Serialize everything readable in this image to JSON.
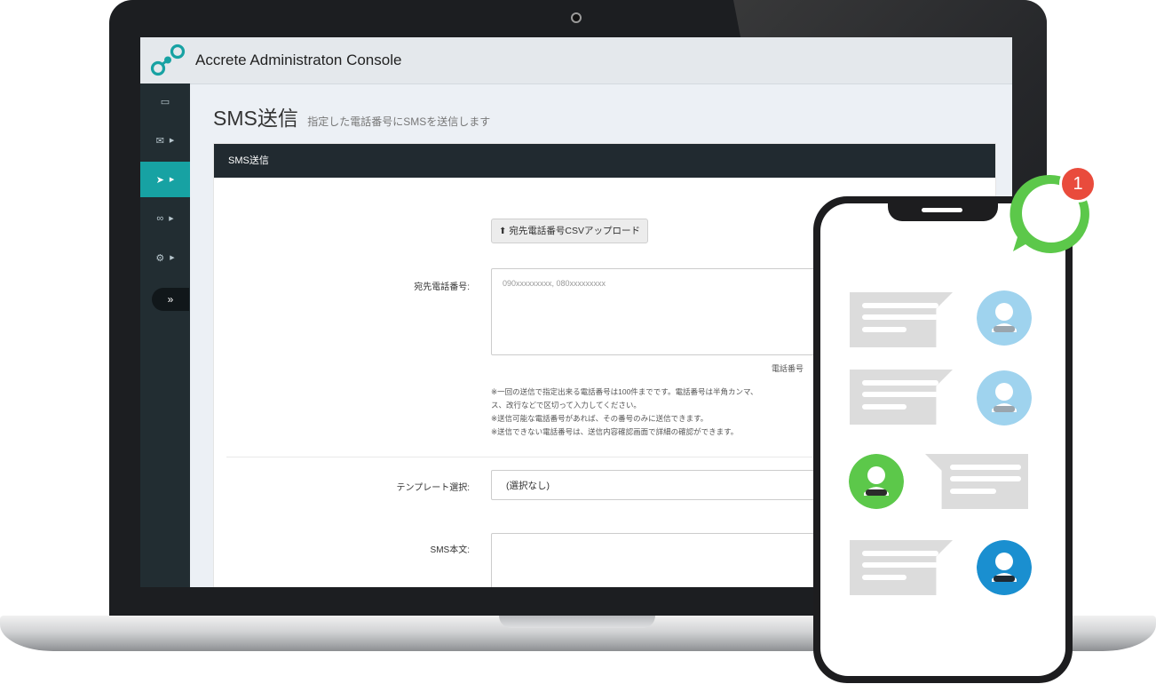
{
  "app": {
    "title": "Accrete Administraton Console"
  },
  "colors": {
    "accent": "#17a2a3",
    "sidebar": "#222d32",
    "panel_header": "#212a30",
    "badge": "#e94b3c",
    "chat_green": "#5cc84a",
    "avatar_blue": "#9fd3ee",
    "avatar_dark_blue": "#1a8fd0"
  },
  "sidebar": {
    "items": [
      {
        "icon": "laptop-icon",
        "glyph": "▭",
        "active": false,
        "has_caret": false
      },
      {
        "icon": "envelope-icon",
        "glyph": "✉",
        "active": false,
        "has_caret": true
      },
      {
        "icon": "paper-plane-icon",
        "glyph": "➤",
        "active": true,
        "has_caret": true
      },
      {
        "icon": "link-icon",
        "glyph": "∞",
        "active": false,
        "has_caret": true
      },
      {
        "icon": "gear-icon",
        "glyph": "⚙",
        "active": false,
        "has_caret": true
      }
    ],
    "collapse_glyph": "»"
  },
  "page": {
    "title": "SMS送信",
    "subtitle": "指定した電話番号にSMSを送信します"
  },
  "panel": {
    "title": "SMS送信",
    "upload_label": "宛先電話番号CSVアップロード",
    "phone_label": "宛先電話番号:",
    "phone_placeholder": "090xxxxxxxxx, 080xxxxxxxxx",
    "counter": "電話番号",
    "notes": [
      "※一回の送信で指定出来る電話番号は100件までです。電話番号は半角カンマ、",
      "ス、改行などで区切って入力してください。",
      "※送信可能な電話番号があれば、その番号のみに送信できます。",
      "※送信できない電話番号は、送信内容確認画面で詳細の確認ができます。"
    ],
    "template_label": "テンプレート選択:",
    "template_value": "(選択なし)",
    "body_label": "SMS本文:"
  },
  "phone": {
    "notification_count": "1",
    "messages": [
      {
        "side": "left",
        "avatar": "user-avatar-light-blue"
      },
      {
        "side": "left",
        "avatar": "user-avatar-light-blue"
      },
      {
        "side": "right",
        "avatar": "user-avatar-green"
      },
      {
        "side": "left",
        "avatar": "user-avatar-dark-blue"
      }
    ]
  }
}
